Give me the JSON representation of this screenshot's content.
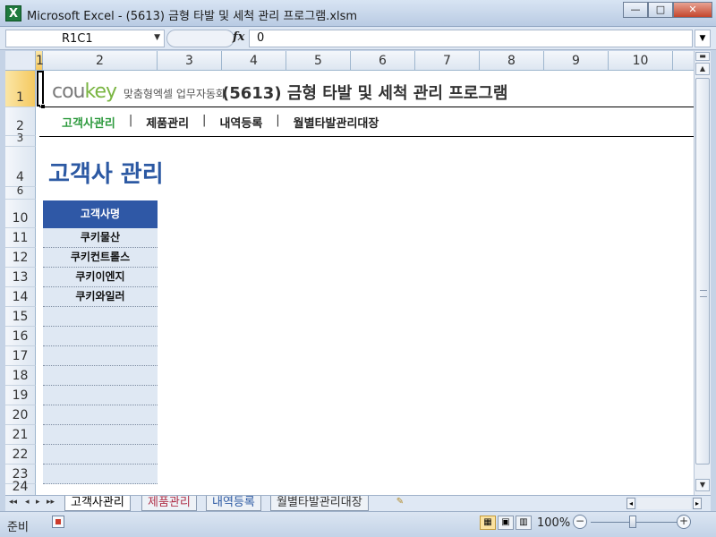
{
  "window": {
    "title": "Microsoft Excel - (5613) 금형 타발 및 세척 관리 프로그램.xlsm",
    "app_icon": "X",
    "minimize": "—",
    "maximize": "□",
    "close": "✕"
  },
  "formula_bar": {
    "name_box": "R1C1",
    "fx_label": "fx",
    "formula_value": "0"
  },
  "columns": [
    "1",
    "2",
    "3",
    "4",
    "5",
    "6",
    "7",
    "8",
    "9",
    "10"
  ],
  "rows": [
    "1",
    "2",
    "3",
    "4",
    "6",
    "10",
    "11",
    "12",
    "13",
    "14",
    "15",
    "16",
    "17",
    "18",
    "19",
    "20",
    "21",
    "22",
    "23",
    "24"
  ],
  "logo": {
    "brand_prefix": "cou",
    "brand_suffix": "key",
    "tagline": "맞춤형엑셀 업무자동화"
  },
  "program_title": "(5613) 금형 타발 및 세척 관리 프로그램",
  "nav": {
    "items": [
      "고객사관리",
      "제품관리",
      "내역등록",
      "월별타발관리대장"
    ],
    "separator": "|"
  },
  "sheet_heading": "고객사 관리",
  "customer_table": {
    "header": "고객사명",
    "rows": [
      "쿠키물산",
      "쿠키컨트롤스",
      "쿠키이엔지",
      "쿠키와일러",
      "",
      "",
      "",
      "",
      "",
      "",
      "",
      "",
      ""
    ]
  },
  "sheet_tabs": {
    "nav": [
      "◂◂",
      "◂",
      "▸",
      "▸▸"
    ],
    "tabs": [
      "고객사관리",
      "제품관리",
      "내역등록",
      "월별타발관리대장"
    ],
    "new_sheet_icon": "✎"
  },
  "status_bar": {
    "status": "준비",
    "zoom": "100%",
    "zoom_minus": "−",
    "zoom_plus": "+"
  },
  "colors": {
    "accent_blue": "#2c59a3",
    "nav_active_green": "#2e9a3e",
    "table_header": "#2f58a6",
    "table_row": "#dfe8f3",
    "selection": "#f5c960"
  }
}
